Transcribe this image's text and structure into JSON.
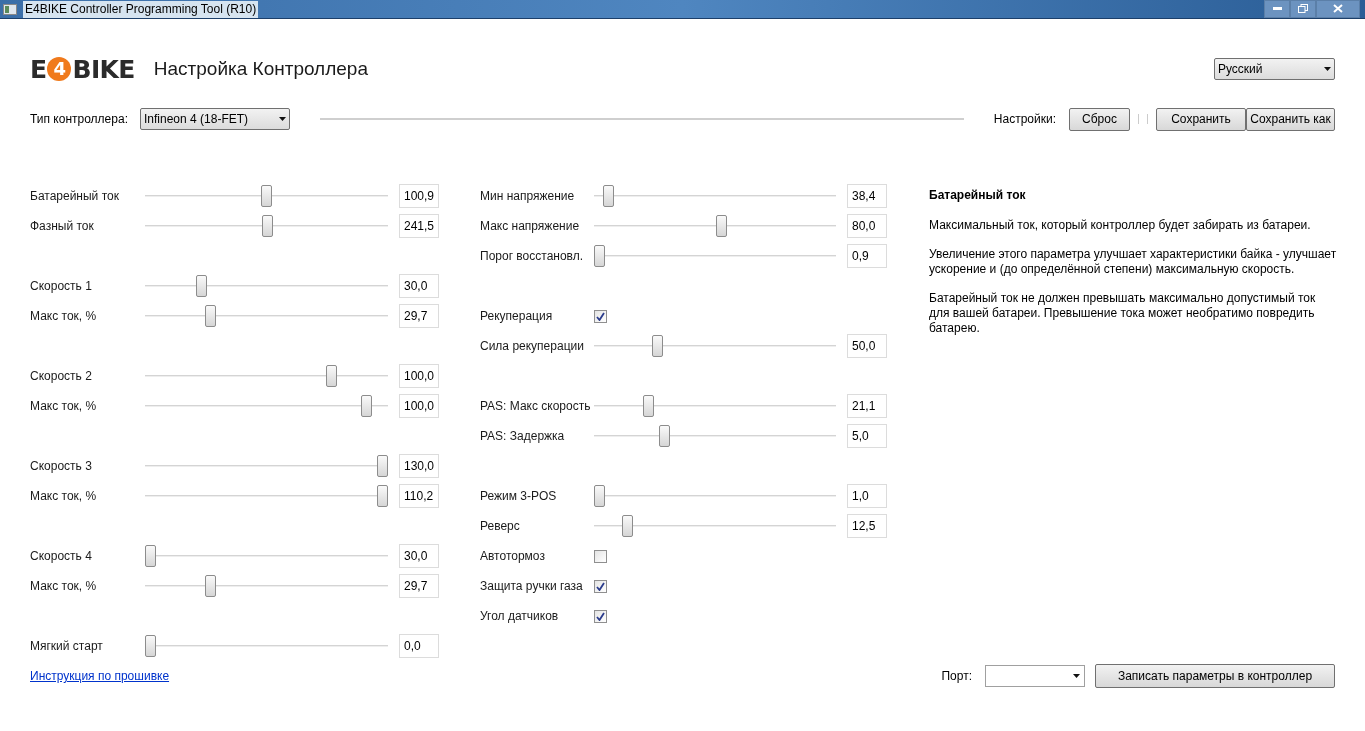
{
  "window": {
    "title": "E4BIKE Controller Programming Tool (R10)"
  },
  "logo": {
    "prefix": "E",
    "badge": "4",
    "suffix": "BIKE"
  },
  "page_title": "Настройка Контроллера",
  "language": {
    "value": "Русский"
  },
  "controller_type": {
    "label": "Тип контроллера:",
    "value": "Infineon 4 (18-FET)"
  },
  "settings": {
    "label": "Настройки:",
    "buttons": [
      "Сброс",
      "Сохранить",
      "Сохранить как"
    ]
  },
  "left_column": [
    [
      {
        "kind": "slider",
        "label": "Батарейный ток",
        "level": 0.5,
        "value": "100,9"
      },
      {
        "kind": "slider",
        "label": "Фазный ток",
        "level": 0.505,
        "value": "241,5"
      }
    ],
    [
      {
        "kind": "slider",
        "label": "Скорость 1",
        "level": 0.22,
        "value": "30,0"
      },
      {
        "kind": "slider",
        "label": "Макс ток, %",
        "level": 0.26,
        "value": "29,7"
      }
    ],
    [
      {
        "kind": "slider",
        "label": "Скорость 2",
        "level": 0.78,
        "value": "100,0"
      },
      {
        "kind": "slider",
        "label": "Макс ток, %",
        "level": 0.93,
        "value": "100,0"
      }
    ],
    [
      {
        "kind": "slider",
        "label": "Скорость 3",
        "level": 1,
        "value": "130,0"
      },
      {
        "kind": "slider",
        "label": "Макс ток, %",
        "level": 1,
        "value": "110,2"
      }
    ],
    [
      {
        "kind": "slider",
        "label": "Скорость 4",
        "level": 0,
        "value": "30,0"
      },
      {
        "kind": "slider",
        "label": "Макс ток, %",
        "level": 0.26,
        "value": "29,7"
      }
    ],
    [
      {
        "kind": "slider",
        "label": "Мягкий старт",
        "level": 0,
        "value": "0,0"
      }
    ]
  ],
  "middle_column": [
    [
      {
        "kind": "slider",
        "label": "Мин напряжение",
        "level": 0.04,
        "value": "38,4"
      },
      {
        "kind": "slider",
        "label": "Макс напряжение",
        "level": 0.53,
        "value": "80,0"
      },
      {
        "kind": "slider",
        "label": "Порог восстановл.",
        "level": 0,
        "value": "0,9"
      }
    ],
    [
      {
        "kind": "checkbox",
        "label": "Рекуперация",
        "checked": true
      },
      {
        "kind": "slider",
        "label": "Сила рекуперации",
        "level": 0.25,
        "value": "50,0"
      }
    ],
    [
      {
        "kind": "slider",
        "label": "PAS: Макс скорость",
        "level": 0.21,
        "value": "21,1"
      },
      {
        "kind": "slider",
        "label": "PAS: Задержка",
        "level": 0.28,
        "value": "5,0"
      }
    ],
    [
      {
        "kind": "slider",
        "label": "Режим 3-POS",
        "level": 0,
        "value": "1,0"
      },
      {
        "kind": "slider",
        "label": "Реверс",
        "level": 0.12,
        "value": "12,5"
      },
      {
        "kind": "checkbox",
        "label": "Автотормоз",
        "checked": false
      },
      {
        "kind": "checkbox",
        "label": "Защита ручки газа",
        "checked": true
      },
      {
        "kind": "checkbox",
        "label": "Угол датчиков",
        "checked": true
      }
    ]
  ],
  "info": {
    "title": "Батарейный ток",
    "paragraphs": [
      "Максимальный ток, который контроллер будет забирать из батареи.",
      "Увеличение этого параметра улучшает характеристики байка - улучшает ускорение и (до определённой степени) максимальную скорость.",
      "Батарейный ток не должен превышать максимально допустимый ток для вашей батареи. Превышение тока может необратимо повредить батарею."
    ]
  },
  "footer": {
    "link": "Инструкция по прошивке",
    "port_label": "Порт:",
    "write_button": "Записать параметры в контроллер"
  }
}
